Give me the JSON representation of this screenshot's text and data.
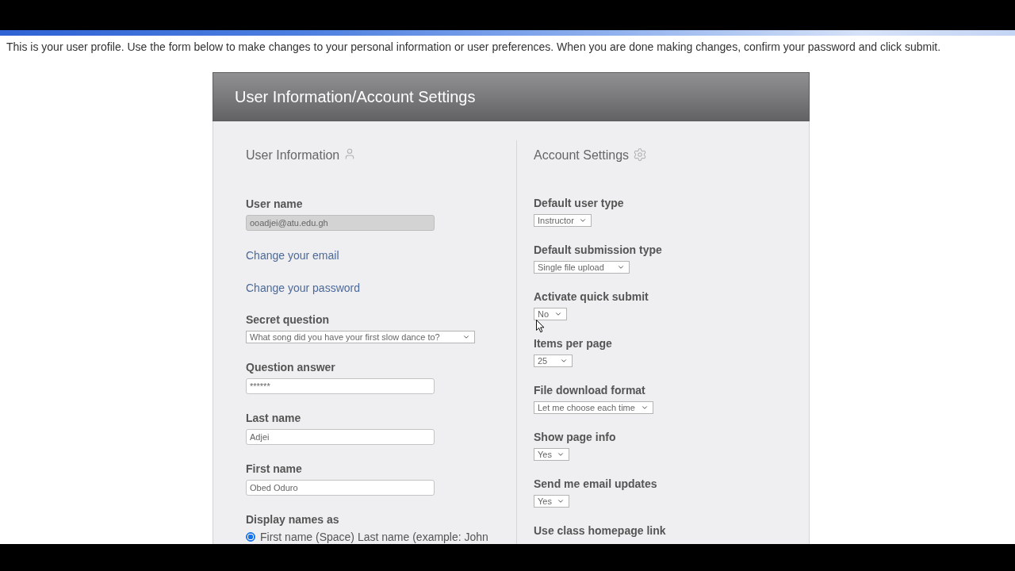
{
  "intro": "This is your user profile. Use the form below to make changes to your personal information or user preferences. When you are done making changes, confirm your password and click submit.",
  "panel": {
    "title": "User Information/Account Settings"
  },
  "user_information": {
    "heading": "User Information",
    "fields": [
      {
        "kind": "input",
        "label": "User name",
        "value": "ooadjei@atu.edu.gh",
        "disabled": true
      },
      {
        "kind": "link",
        "label": "Change your email"
      },
      {
        "kind": "link",
        "label": "Change your password"
      },
      {
        "kind": "select",
        "label": "Secret question",
        "value": "What song did you have your first slow dance to?"
      },
      {
        "kind": "input",
        "label": "Question answer",
        "value": "******",
        "disabled": false
      },
      {
        "kind": "input",
        "label": "Last name",
        "value": "Adjei",
        "disabled": false
      },
      {
        "kind": "input",
        "label": "First name",
        "value": "Obed Oduro",
        "disabled": false
      },
      {
        "kind": "radio",
        "label": "Display names as",
        "options": [
          {
            "label": "First name (Space) Last name (example: John",
            "selected": true
          }
        ]
      }
    ]
  },
  "account_settings": {
    "heading": "Account Settings",
    "fields": [
      {
        "kind": "select",
        "label": "Default user type",
        "value": "Instructor"
      },
      {
        "kind": "select",
        "label": "Default submission type",
        "value": "Single file upload"
      },
      {
        "kind": "select",
        "label": "Activate quick submit",
        "value": "No"
      },
      {
        "kind": "select",
        "label": "Items per page",
        "value": "25"
      },
      {
        "kind": "select",
        "label": "File download format",
        "value": "Let me choose each time"
      },
      {
        "kind": "select",
        "label": "Show page info",
        "value": "Yes"
      },
      {
        "kind": "select",
        "label": "Send me email updates",
        "value": "Yes"
      },
      {
        "kind": "label",
        "label": "Use class homepage link"
      }
    ]
  }
}
